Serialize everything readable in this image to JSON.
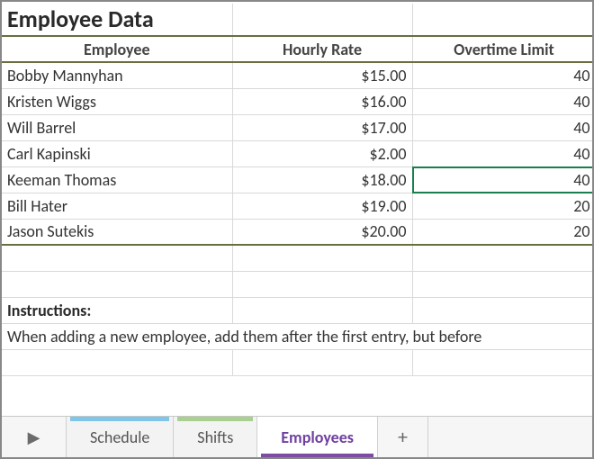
{
  "title": "Employee Data",
  "columns": [
    "Employee",
    "Hourly Rate",
    "Overtime Limit"
  ],
  "rows": [
    {
      "name": "Bobby Mannyhan",
      "rate": "$15.00",
      "limit": "40"
    },
    {
      "name": "Kristen Wiggs",
      "rate": "$16.00",
      "limit": "40"
    },
    {
      "name": "Will Barrel",
      "rate": "$17.00",
      "limit": "40"
    },
    {
      "name": "Carl Kapinski",
      "rate": "$2.00",
      "limit": "40"
    },
    {
      "name": "Keeman Thomas",
      "rate": "$18.00",
      "limit": "40"
    },
    {
      "name": "Bill Hater",
      "rate": "$19.00",
      "limit": "20"
    },
    {
      "name": "Jason Sutekis",
      "rate": "$20.00",
      "limit": "20"
    }
  ],
  "selected": {
    "row_index": 4,
    "col": "limit"
  },
  "instructions_label": "Instructions:",
  "instructions_text": "When adding a new employee, add them after the first entry, but before",
  "tabs": {
    "schedule": "Schedule",
    "shifts": "Shifts",
    "employees": "Employees",
    "active": "employees"
  },
  "icons": {
    "nav": "▶",
    "plus": "+"
  }
}
